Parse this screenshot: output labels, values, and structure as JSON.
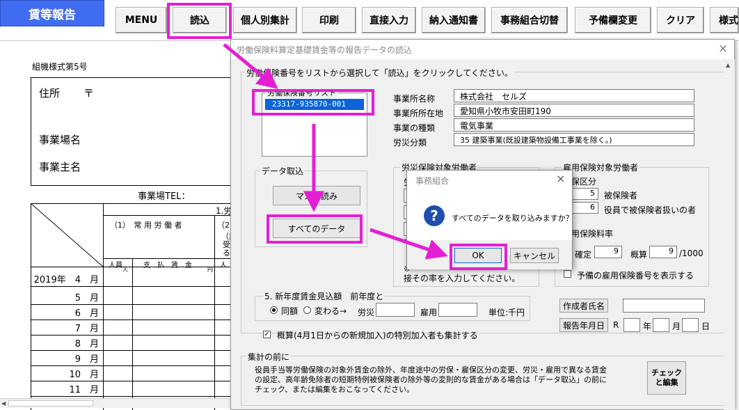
{
  "toolbar": {
    "title": "賃等報告",
    "buttons": [
      "MENU",
      "読込",
      "個人別集計",
      "印刷",
      "直接入力",
      "納入通知書",
      "事務組合切替",
      "予備欄変更",
      "クリア",
      "様式"
    ]
  },
  "sheet": {
    "form_id": "組機様式第5号",
    "address_label": "住所",
    "postal_mark": "〒",
    "workplace_label": "事業場名",
    "owner_label": "事業主名",
    "tel_label": "事業場TEL：",
    "section_1": "1.労",
    "col1_header": "（1）　常 用 労 働 者",
    "col2_header": "（2",
    "col2_fragment_1": "（業",
    "col2_fragment_2": "受",
    "col2_fragment_3": "る",
    "unit_people": "人員",
    "unit_wage": "支　払　賃　金",
    "unit_people_2": "人",
    "unit_person_mark": "人",
    "unit_yen_mark": "円",
    "rows": [
      "2019年　4　月",
      "5　月",
      "6　月",
      "7　月",
      "8　月",
      "9　月",
      "10　月",
      "11　月"
    ]
  },
  "dialog": {
    "title": "労働保険料算定基礎賃金等の報告データの読込",
    "close_icon": "×",
    "instruction": "労働保険番号をリストから選択して「読込」をクリックしてください。",
    "list_label": "労働保険番号リスト",
    "list_items": [
      "23317-935870-001"
    ],
    "info": {
      "name_label": "事業所名称",
      "name_value": "株式会社　セルズ",
      "address_label": "事業所所在地",
      "address_value": "愛知県小牧市安田町190",
      "business_label": "事業の種類",
      "business_value": "電気事業",
      "category_label": "労災分類",
      "category_value": "35 建築事業(既設建築物設備工事業を除く。)"
    },
    "import_group": "データ取込",
    "manual_button": "マスタ読み",
    "all_data_button": "すべてのデータ",
    "rosai_group": "労災保険対象労働者",
    "rosai_fragment_1": "労",
    "rosai_fragment_2": "※",
    "rosai_fragment_3": "※",
    "rosai_note": "接その率を入力してください。",
    "koyo_group": "雇用保険対象労働者",
    "koyo_class": "保区分",
    "insured_count": "5",
    "insured_label": "被保険者",
    "officer_count": "6",
    "officer_label": "役員で被保険者扱いの者",
    "koyo_rate_label": "用保険料率",
    "confirmed_label": "確定",
    "confirmed_value": "9",
    "estimated_label": "概算",
    "estimated_value": "9",
    "rate_denominator": "/1000",
    "reserve_check_label": "予備の雇用保険番号を表示する",
    "next_year_group": "5. 新年度賃金見込額　前年度と",
    "same_label": "同額",
    "change_label": "変わる→",
    "rosai_short": "労災",
    "koyo_short": "雇用",
    "unit_label": "単位:千円",
    "estimate_check_label": "概算(4月1日からの新規加入)の特別加入者も集計する",
    "creator_button": "作成者氏名",
    "date_button": "報告年月日",
    "era_label": "R",
    "year_label": "年",
    "month_label": "月",
    "day_label": "日",
    "summary_group": "集計の前に",
    "summary_text_1": "役員手当等労働保険の対象外賃金の除外、年度途中の労保・雇保区分の変更、労災・雇用で異なる賃金",
    "summary_text_2": "の設定、高年齢免除者の短期特例被保険者の除外等の変則的な賃金がある場合は「データ取込」の前に",
    "summary_text_3": "チェック、または編集をおこなってください。",
    "check_button_1": "チェック",
    "check_button_2": "と編集"
  },
  "confirm": {
    "title": "事務組合",
    "close_icon": "×",
    "message": "すべてのデータを取り込みますか？",
    "ok": "OK",
    "cancel": "キャンセル"
  },
  "colors": {
    "highlight": "#e41fd3",
    "title_button": "#3f6cf0",
    "selection": "#0a64d8"
  }
}
